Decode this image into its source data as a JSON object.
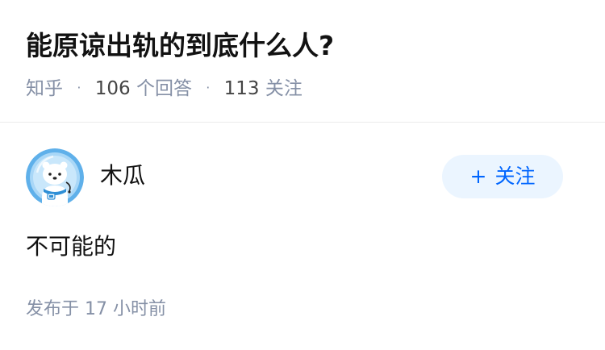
{
  "question": {
    "title": "能原谅出轨的到底什么人?",
    "source": "知乎",
    "answer_count": "106",
    "answer_label": "个回答",
    "follow_count": "113",
    "follow_label": "关注",
    "separator": "·"
  },
  "answer": {
    "author_name": "木瓜",
    "follow_button_plus": "+",
    "follow_button_label": "关注",
    "content": "不可能的",
    "published_label": "发布于",
    "published_time": "17 小时前"
  },
  "colors": {
    "title": "#121212",
    "meta": "#8590a6",
    "accent": "#0066ff",
    "follow_button_bg": "#ebf5ff",
    "avatar_bg": "#5fb0ea"
  },
  "icons": {
    "avatar": "polar-bear-astronaut-avatar"
  }
}
